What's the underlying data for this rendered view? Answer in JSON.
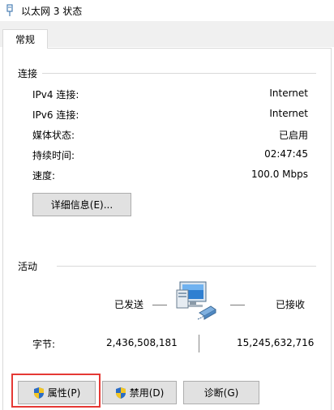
{
  "window": {
    "title": "以太网 3 状态"
  },
  "tabs": [
    {
      "label": "常规"
    }
  ],
  "connection": {
    "heading": "连接",
    "rows": [
      {
        "label": "IPv4 连接:",
        "value": "Internet"
      },
      {
        "label": "IPv6 连接:",
        "value": "Internet"
      },
      {
        "label": "媒体状态:",
        "value": "已启用"
      },
      {
        "label": "持续时间:",
        "value": "02:47:45"
      },
      {
        "label": "速度:",
        "value": "100.0 Mbps"
      }
    ],
    "details_button": "详细信息(E)..."
  },
  "activity": {
    "heading": "活动",
    "sent_label": "已发送",
    "received_label": "已接收",
    "bytes_label": "字节:",
    "bytes_sent": "2,436,508,181",
    "bytes_received": "15,245,632,716"
  },
  "buttons": {
    "properties": "属性(P)",
    "disable": "禁用(D)",
    "diagnose": "诊断(G)"
  },
  "icons": {
    "window": "network-adapter-icon",
    "activity": "network-computers-icon",
    "uac": "uac-shield-icon"
  },
  "colors": {
    "highlight_box": "#e53935",
    "button_face": "#e1e1e1",
    "group_line": "#d9d9d9"
  }
}
